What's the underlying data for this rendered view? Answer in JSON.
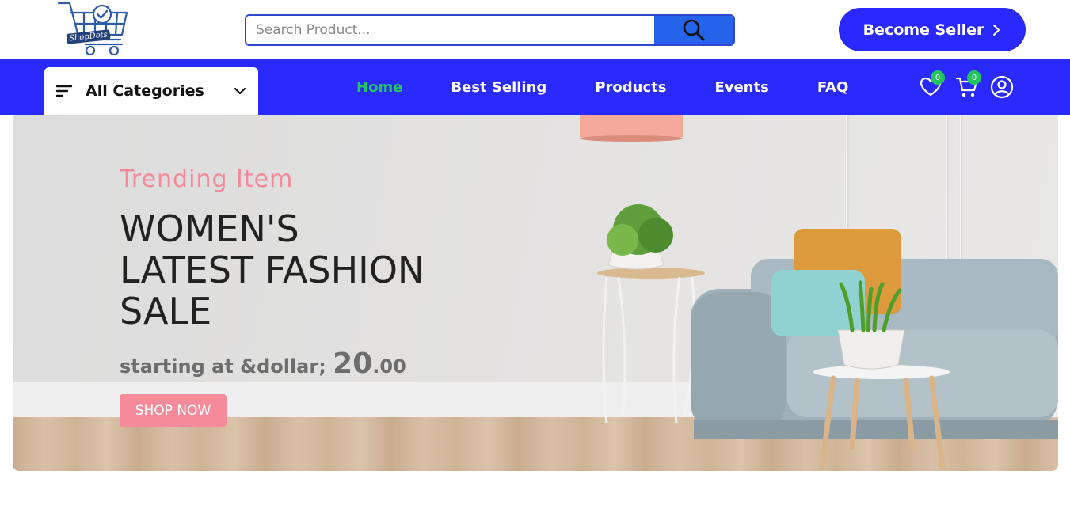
{
  "brand": {
    "logo_text": "ShopDots"
  },
  "search": {
    "placeholder": "Search Product...",
    "value": ""
  },
  "header": {
    "seller_button": "Become Seller"
  },
  "categories": {
    "label": "All Categories"
  },
  "nav": {
    "links": [
      {
        "label": "Home",
        "active": true
      },
      {
        "label": "Best Selling",
        "active": false
      },
      {
        "label": "Products",
        "active": false
      },
      {
        "label": "Events",
        "active": false
      },
      {
        "label": "FAQ",
        "active": false
      }
    ],
    "wishlist_count": "0",
    "cart_count": "0"
  },
  "hero": {
    "subtitle": "Trending Item",
    "title_lines": [
      "WOMEN'S",
      "LATEST FASHION",
      "SALE"
    ],
    "price_prefix": "starting at &dollar; ",
    "price_whole": "20",
    "price_cents": ".00",
    "button": "SHOP NOW"
  },
  "colors": {
    "primary": "#2a2aff",
    "search_button": "#2563eb",
    "accent_green": "#22c55e",
    "accent_pink": "#f48a9a"
  }
}
